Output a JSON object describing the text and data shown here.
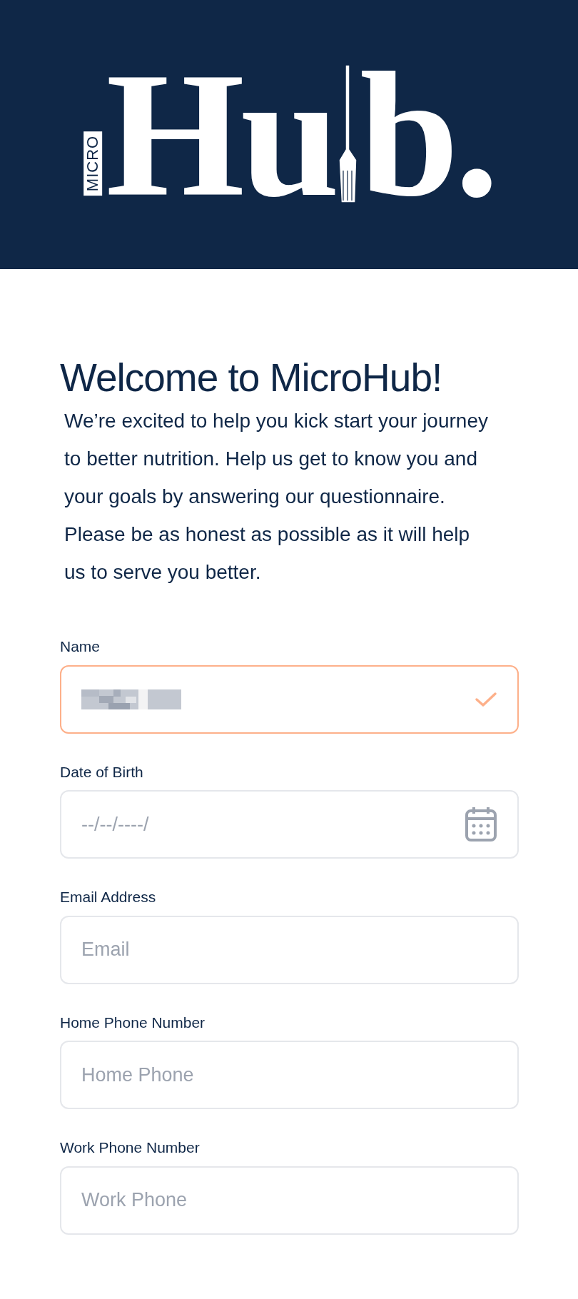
{
  "logo": {
    "small": "MICRO",
    "large_start": "Hu",
    "large_end": "b."
  },
  "welcome": {
    "title": "Welcome to MicroHub!",
    "text": "We’re excited to help you kick start your journey to better nutrition. Help us get to know you and your goals by answering our questionnaire. Please be as honest as possible as it will help us to serve you better."
  },
  "fields": [
    {
      "label": "Name",
      "kind": "text",
      "redacted": true,
      "valid": true
    },
    {
      "label": "Date of Birth",
      "kind": "date",
      "placeholder": "--/--/----/",
      "valid": false
    },
    {
      "label": "Email Address",
      "kind": "text",
      "placeholder": "Email",
      "valid": false
    },
    {
      "label": "Home Phone Number",
      "kind": "text",
      "placeholder": "Home Phone",
      "valid": false
    },
    {
      "label": "Work Phone Number",
      "kind": "text",
      "placeholder": "Work Phone",
      "valid": false
    }
  ]
}
